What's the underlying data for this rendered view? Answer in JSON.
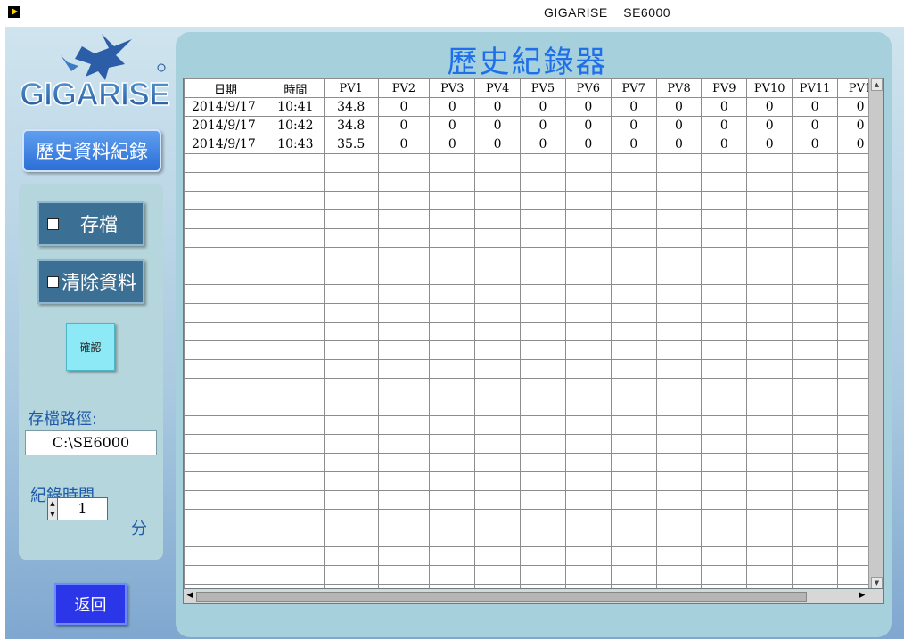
{
  "window": {
    "title": "GIGARISE    SE6000"
  },
  "logo": {
    "text": "GIGARISE"
  },
  "sidebar": {
    "mode_button": "歷史資料紀錄",
    "save_toggle": "存檔",
    "clear_toggle": "清除資料",
    "confirm_button": "確認",
    "path_label": "存檔路徑:",
    "path_value": "C:\\SE6000",
    "record_label": "紀錄時間",
    "record_value": "1",
    "record_unit": "分",
    "back_button": "返回"
  },
  "main": {
    "title": "歷史紀錄器",
    "columns": [
      "日期",
      "時間",
      "PV1",
      "PV2",
      "PV3",
      "PV4",
      "PV5",
      "PV6",
      "PV7",
      "PV8",
      "PV9",
      "PV10",
      "PV11",
      "PV1"
    ],
    "rows": [
      [
        "2014/9/17",
        "10:41",
        "34.8",
        "0",
        "0",
        "0",
        "0",
        "0",
        "0",
        "0",
        "0",
        "0",
        "0",
        "0"
      ],
      [
        "2014/9/17",
        "10:42",
        "34.8",
        "0",
        "0",
        "0",
        "0",
        "0",
        "0",
        "0",
        "0",
        "0",
        "0",
        "0"
      ],
      [
        "2014/9/17",
        "10:43",
        "35.5",
        "0",
        "0",
        "0",
        "0",
        "0",
        "0",
        "0",
        "0",
        "0",
        "0",
        "0"
      ]
    ],
    "empty_rows": 24
  },
  "colors": {
    "accent": "#1e6fe8",
    "back_button": "#2b36e8",
    "confirm_button": "#8ee9f7"
  }
}
